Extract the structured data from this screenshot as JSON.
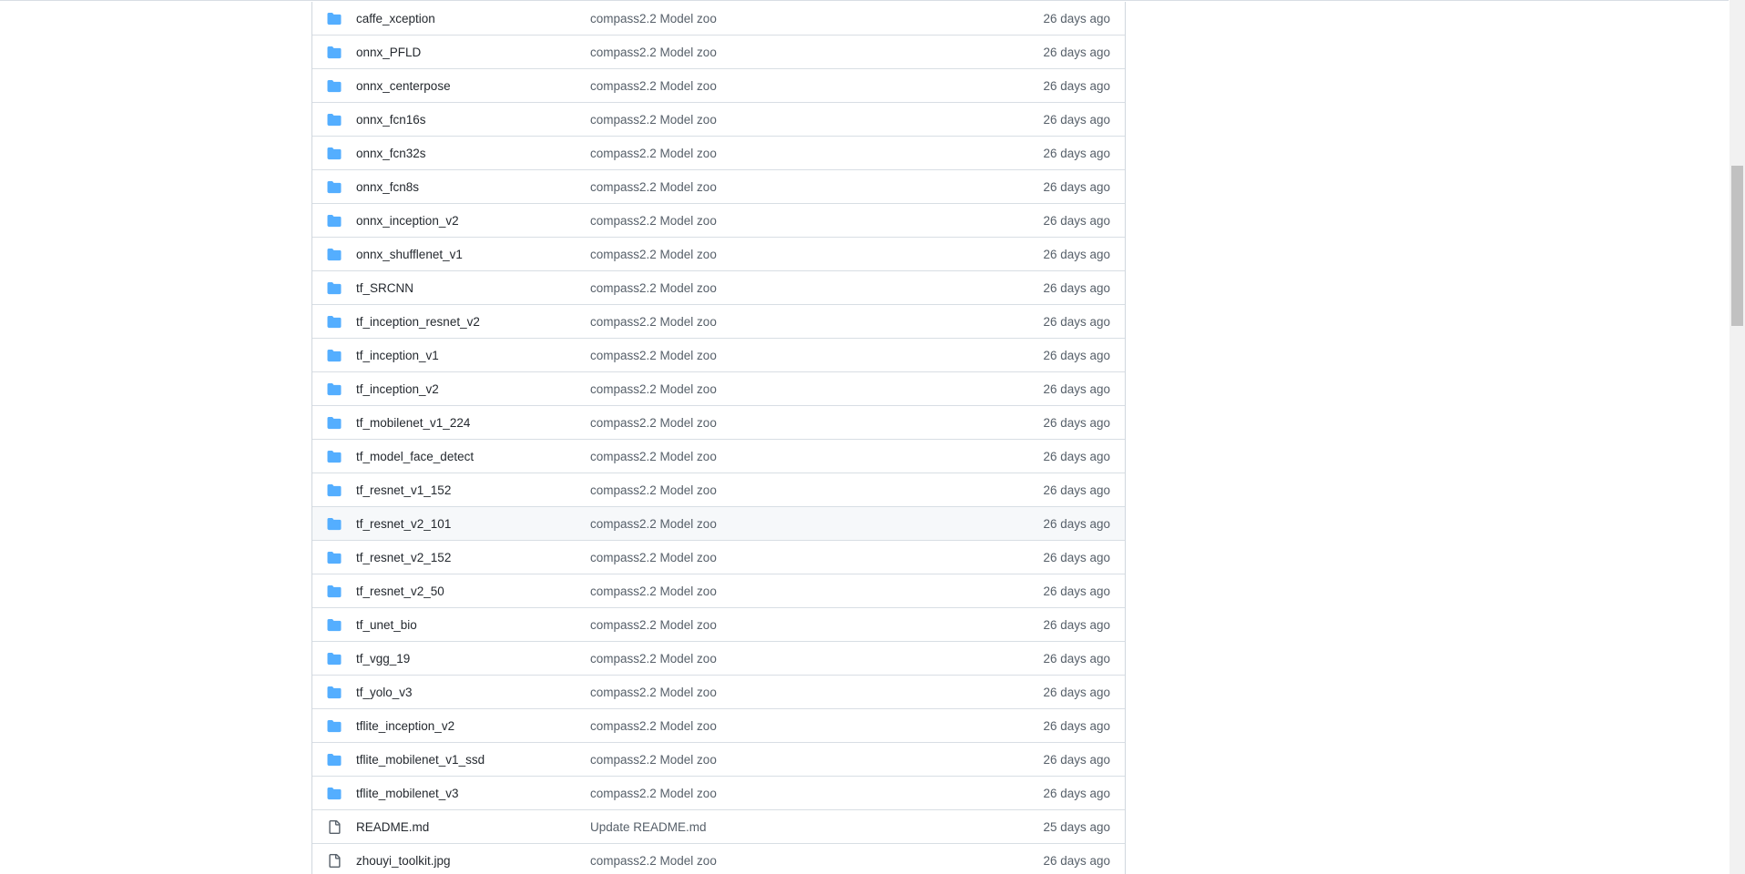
{
  "files": [
    {
      "type": "dir",
      "name": "caffe_xception",
      "message": "compass2.2 Model zoo",
      "age": "26 days ago"
    },
    {
      "type": "dir",
      "name": "onnx_PFLD",
      "message": "compass2.2 Model zoo",
      "age": "26 days ago"
    },
    {
      "type": "dir",
      "name": "onnx_centerpose",
      "message": "compass2.2 Model zoo",
      "age": "26 days ago"
    },
    {
      "type": "dir",
      "name": "onnx_fcn16s",
      "message": "compass2.2 Model zoo",
      "age": "26 days ago"
    },
    {
      "type": "dir",
      "name": "onnx_fcn32s",
      "message": "compass2.2 Model zoo",
      "age": "26 days ago"
    },
    {
      "type": "dir",
      "name": "onnx_fcn8s",
      "message": "compass2.2 Model zoo",
      "age": "26 days ago"
    },
    {
      "type": "dir",
      "name": "onnx_inception_v2",
      "message": "compass2.2 Model zoo",
      "age": "26 days ago"
    },
    {
      "type": "dir",
      "name": "onnx_shufflenet_v1",
      "message": "compass2.2 Model zoo",
      "age": "26 days ago"
    },
    {
      "type": "dir",
      "name": "tf_SRCNN",
      "message": "compass2.2 Model zoo",
      "age": "26 days ago"
    },
    {
      "type": "dir",
      "name": "tf_inception_resnet_v2",
      "message": "compass2.2 Model zoo",
      "age": "26 days ago"
    },
    {
      "type": "dir",
      "name": "tf_inception_v1",
      "message": "compass2.2 Model zoo",
      "age": "26 days ago"
    },
    {
      "type": "dir",
      "name": "tf_inception_v2",
      "message": "compass2.2 Model zoo",
      "age": "26 days ago"
    },
    {
      "type": "dir",
      "name": "tf_mobilenet_v1_224",
      "message": "compass2.2 Model zoo",
      "age": "26 days ago"
    },
    {
      "type": "dir",
      "name": "tf_model_face_detect",
      "message": "compass2.2 Model zoo",
      "age": "26 days ago"
    },
    {
      "type": "dir",
      "name": "tf_resnet_v1_152",
      "message": "compass2.2 Model zoo",
      "age": "26 days ago"
    },
    {
      "type": "dir",
      "name": "tf_resnet_v2_101",
      "message": "compass2.2 Model zoo",
      "age": "26 days ago",
      "hover": true
    },
    {
      "type": "dir",
      "name": "tf_resnet_v2_152",
      "message": "compass2.2 Model zoo",
      "age": "26 days ago"
    },
    {
      "type": "dir",
      "name": "tf_resnet_v2_50",
      "message": "compass2.2 Model zoo",
      "age": "26 days ago"
    },
    {
      "type": "dir",
      "name": "tf_unet_bio",
      "message": "compass2.2 Model zoo",
      "age": "26 days ago"
    },
    {
      "type": "dir",
      "name": "tf_vgg_19",
      "message": "compass2.2 Model zoo",
      "age": "26 days ago"
    },
    {
      "type": "dir",
      "name": "tf_yolo_v3",
      "message": "compass2.2 Model zoo",
      "age": "26 days ago"
    },
    {
      "type": "dir",
      "name": "tflite_inception_v2",
      "message": "compass2.2 Model zoo",
      "age": "26 days ago"
    },
    {
      "type": "dir",
      "name": "tflite_mobilenet_v1_ssd",
      "message": "compass2.2 Model zoo",
      "age": "26 days ago"
    },
    {
      "type": "dir",
      "name": "tflite_mobilenet_v3",
      "message": "compass2.2 Model zoo",
      "age": "26 days ago"
    },
    {
      "type": "file",
      "name": "README.md",
      "message": "Update README.md",
      "age": "25 days ago"
    },
    {
      "type": "file",
      "name": "zhouyi_toolkit.jpg",
      "message": "compass2.2 Model zoo",
      "age": "26 days ago"
    }
  ],
  "icons": {
    "dir": "folder-icon",
    "file": "file-icon"
  },
  "colors": {
    "folder": "#54aeff",
    "file_icon": "#57606a",
    "hover_row": "#f6f8fa",
    "border": "#d0d7de"
  }
}
